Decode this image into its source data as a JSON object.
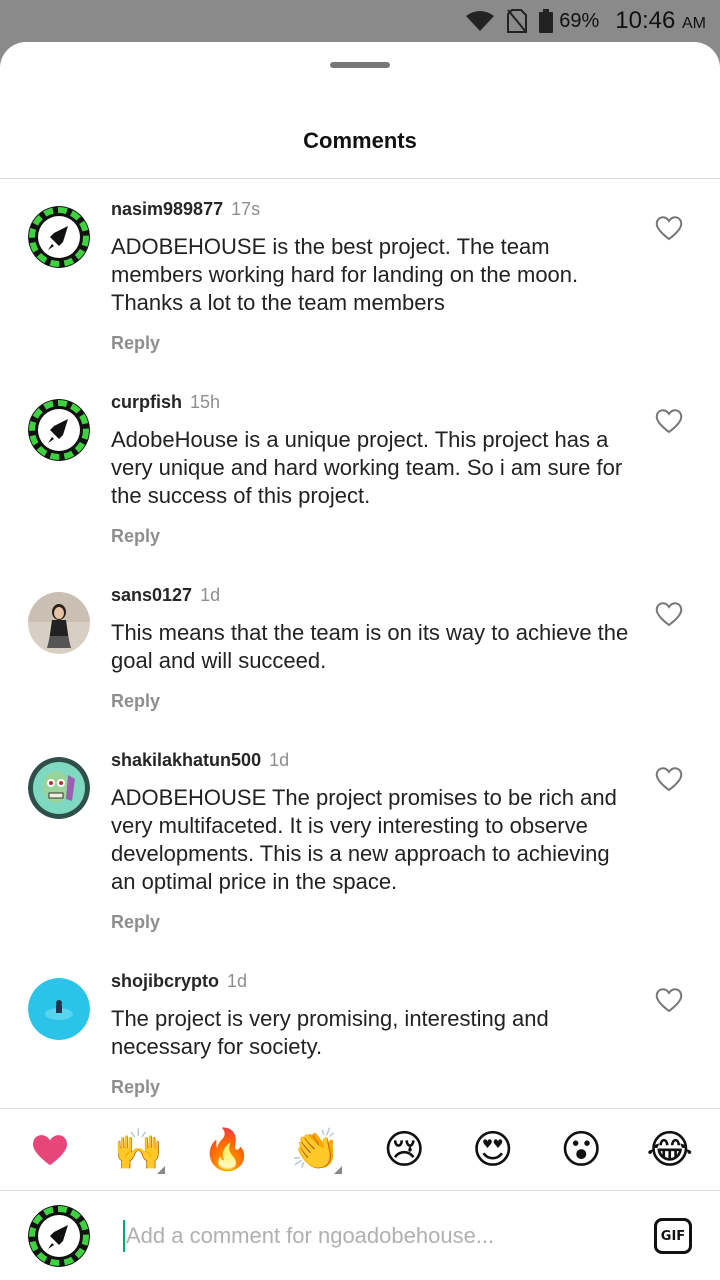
{
  "status_bar": {
    "battery_percent": "69%",
    "time": "10:46",
    "ampm": "AM",
    "icons": [
      "wifi-icon",
      "no-sim-icon",
      "battery-icon"
    ]
  },
  "sheet": {
    "title": "Comments"
  },
  "comments": [
    {
      "username": "nasim989877",
      "time": "17s",
      "text": "ADOBEHOUSE is the best project. The team members working hard for landing on the moon. Thanks a lot to the team members",
      "reply_label": "Reply",
      "avatar": "rocket-logo"
    },
    {
      "username": "curpfish",
      "time": "15h",
      "text": "AdobeHouse is a unique project. This project has a very unique and hard working team. So i am sure for the success of this project.",
      "reply_label": "Reply",
      "avatar": "rocket-logo"
    },
    {
      "username": "sans0127",
      "time": "1d",
      "text": "This means that the team is on its way to achieve the goal and will succeed.",
      "reply_label": "Reply",
      "avatar": "person-photo"
    },
    {
      "username": "shakilakhatun500",
      "time": "1d",
      "text": "ADOBEHOUSE The project promises to be rich and very multifaceted. It is very interesting to observe developments. This is a new approach to achieving an optimal price in the space.",
      "reply_label": "Reply",
      "avatar": "zombie-illustration"
    },
    {
      "username": "shojibcrypto",
      "time": "1d",
      "text": "The project is very promising, interesting and necessary for society.",
      "reply_label": "Reply",
      "avatar": "blue-photo"
    }
  ],
  "reactions": [
    "❤",
    "🙌",
    "🔥",
    "👏",
    "😢",
    "😍",
    "😮",
    "😂"
  ],
  "composer": {
    "placeholder": "Add a comment for ngoadobehouse...",
    "gif_label": "GIF"
  },
  "colors": {
    "heart_reaction": "#e8457a",
    "caret": "#00aa77",
    "rocket_ring": "#3fd13f"
  }
}
